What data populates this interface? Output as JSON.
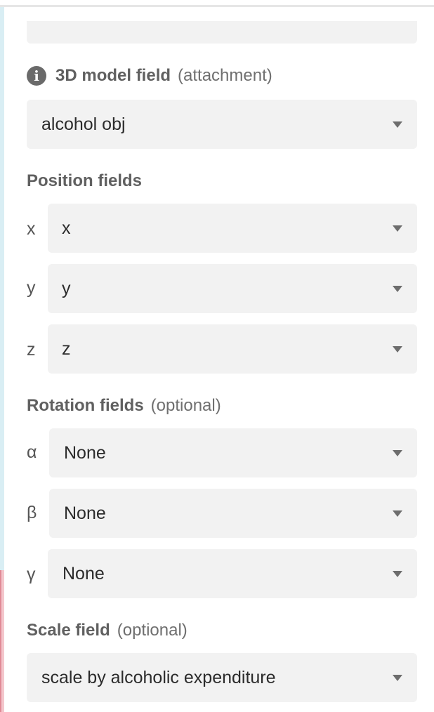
{
  "model_field": {
    "label": "3D model field",
    "hint": "(attachment)",
    "value": "alcohol obj"
  },
  "position": {
    "title": "Position fields",
    "fields": [
      {
        "axis": "x",
        "value": "x"
      },
      {
        "axis": "y",
        "value": "y"
      },
      {
        "axis": "z",
        "value": "z"
      }
    ]
  },
  "rotation": {
    "title": "Rotation fields",
    "hint": "(optional)",
    "fields": [
      {
        "axis": "α",
        "value": "None"
      },
      {
        "axis": "β",
        "value": "None"
      },
      {
        "axis": "γ",
        "value": "None"
      }
    ]
  },
  "scale": {
    "title": "Scale field",
    "hint": "(optional)",
    "value": "scale by alcoholic expenditure"
  },
  "icons": {
    "info": "i",
    "info_name": "info-icon",
    "caret_name": "chevron-down-icon"
  },
  "colors": {
    "select_bg": "#f2f2f2",
    "label_text": "#5f5f5f",
    "left_accent_top": "#d9eef4",
    "left_accent_bottom": "#f4c6cc"
  }
}
